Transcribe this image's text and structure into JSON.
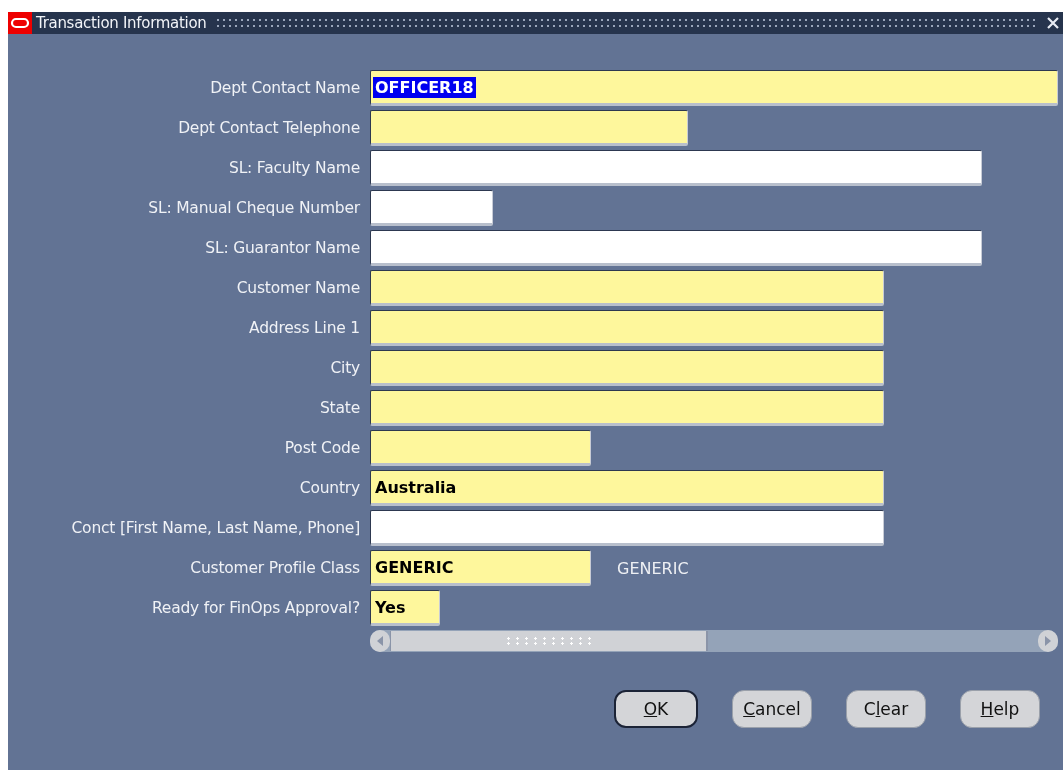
{
  "window": {
    "title": "Transaction Information"
  },
  "fields": [
    {
      "label": "Dept Contact Name",
      "value": "OFFICER18",
      "required": true,
      "highlighted": true
    },
    {
      "label": "Dept Contact Telephone",
      "required": true,
      "highlighted": false
    },
    {
      "label": "SL: Faculty Name",
      "required": false,
      "highlighted": false
    },
    {
      "label": "SL: Manual Cheque Number",
      "required": false,
      "highlighted": false
    },
    {
      "label": "SL: Guarantor Name",
      "required": false,
      "highlighted": false
    },
    {
      "label": "Customer Name",
      "required": true,
      "highlighted": false
    },
    {
      "label": "Address Line 1",
      "required": true,
      "highlighted": false
    },
    {
      "label": "City",
      "required": true,
      "highlighted": false
    },
    {
      "label": "State",
      "required": true,
      "highlighted": false
    },
    {
      "label": "Post Code",
      "required": true,
      "highlighted": false
    },
    {
      "label": "Country",
      "value": "Australia",
      "required": true,
      "highlighted": false
    },
    {
      "label": "Conct [First Name, Last Name, Phone]",
      "required": false,
      "highlighted": false
    },
    {
      "label": "Customer Profile Class",
      "value": "GENERIC",
      "description": "GENERIC",
      "required": true,
      "highlighted": false
    },
    {
      "label": "Ready for FinOps Approval?",
      "value": "Yes",
      "required": true,
      "highlighted": false
    }
  ],
  "buttons": [
    {
      "label": "OK",
      "default": true
    },
    {
      "label": "Cancel",
      "default": false
    },
    {
      "label": "Clear",
      "default": false
    },
    {
      "label": "Help",
      "default": false
    }
  ]
}
